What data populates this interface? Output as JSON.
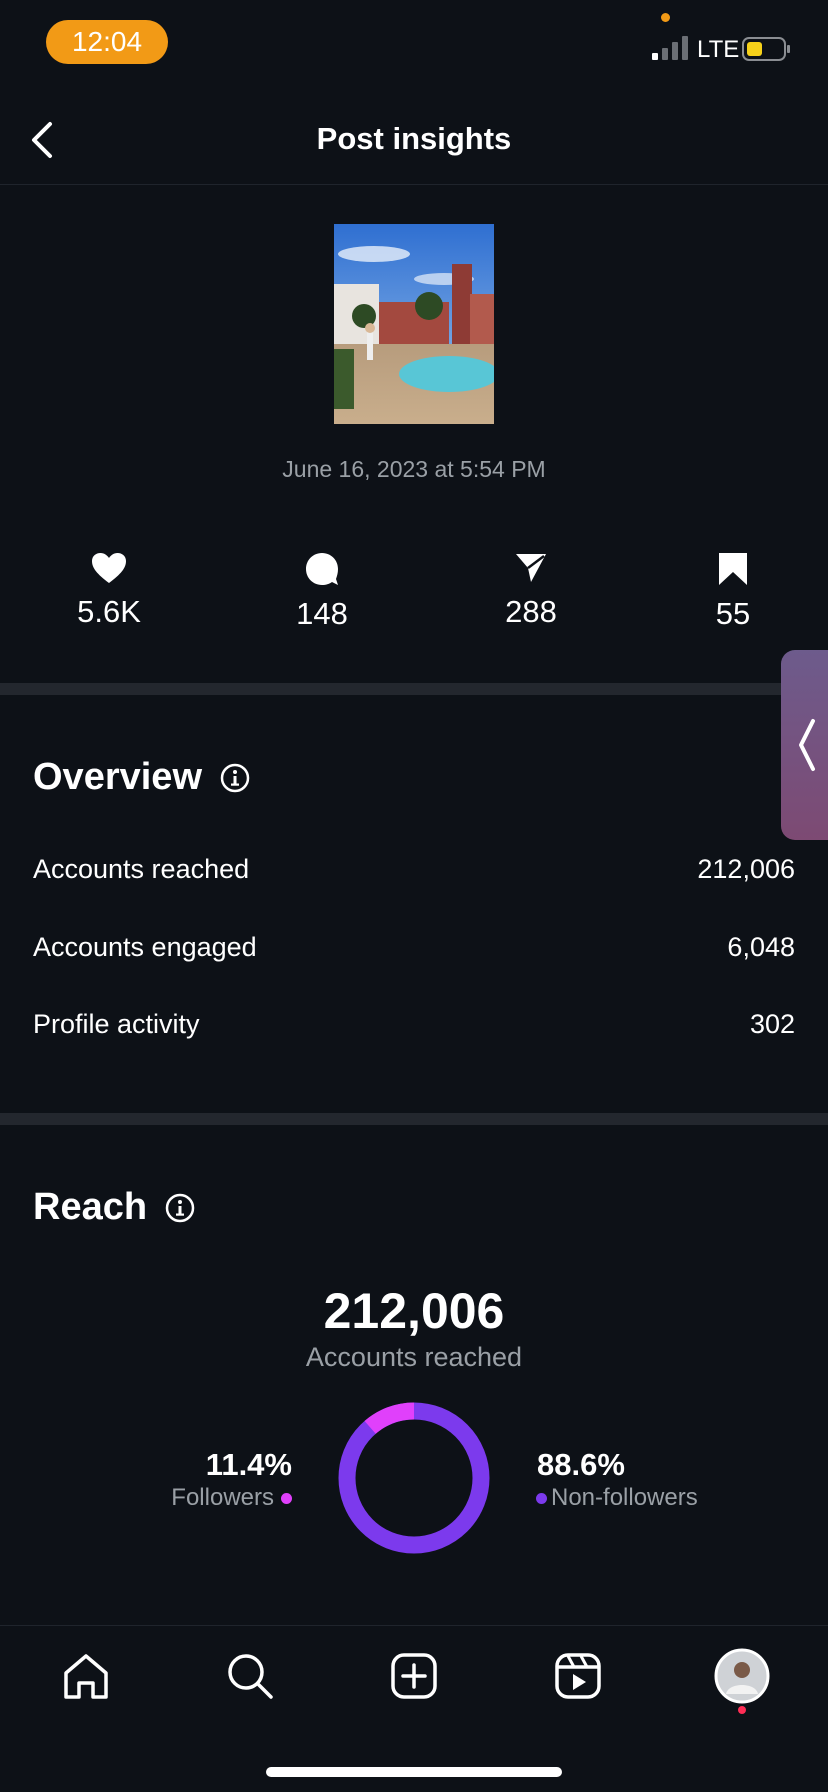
{
  "status_bar": {
    "time": "12:04",
    "network": "LTE"
  },
  "header": {
    "title": "Post insights"
  },
  "post": {
    "date": "June 16, 2023 at 5:54 PM"
  },
  "metrics": [
    {
      "icon": "heart-icon",
      "value": "5.6K"
    },
    {
      "icon": "comment-icon",
      "value": "148"
    },
    {
      "icon": "share-icon",
      "value": "288"
    },
    {
      "icon": "bookmark-icon",
      "value": "55"
    }
  ],
  "overview": {
    "title": "Overview",
    "rows": [
      {
        "label": "Accounts reached",
        "value": "212,006"
      },
      {
        "label": "Accounts engaged",
        "value": "6,048"
      },
      {
        "label": "Profile activity",
        "value": "302"
      }
    ]
  },
  "reach": {
    "title": "Reach",
    "total": "212,006",
    "caption": "Accounts reached",
    "followers_pct": "11.4%",
    "followers_label": "Followers",
    "followers_fraction": 0.114,
    "non_followers_pct": "88.6%",
    "non_followers_label": "Non-followers",
    "non_followers_fraction": 0.886,
    "colors": {
      "followers": "#e040fb",
      "non_followers": "#7c3aed"
    }
  },
  "bottom_nav": [
    "home-icon",
    "search-icon",
    "create-icon",
    "reels-icon",
    "profile-avatar"
  ]
}
